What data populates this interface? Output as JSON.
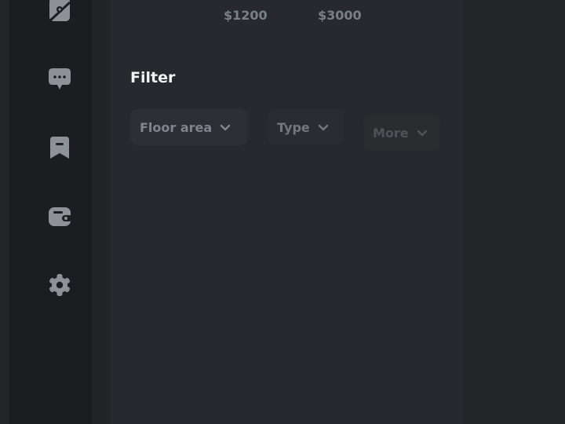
{
  "prices": {
    "min": "$1200",
    "max": "$3000"
  },
  "filter": {
    "title": "Filter",
    "chips": [
      {
        "label": "Floor area"
      },
      {
        "label": "Type"
      },
      {
        "label": "More"
      }
    ]
  },
  "sidebar": {
    "icons": [
      "map-icon",
      "chat-icon",
      "bookmark-icon",
      "wallet-icon",
      "settings-icon"
    ]
  },
  "colors": {
    "background": "#232529",
    "sidebar": "#1b1d20",
    "panel": "#27292e",
    "icon": "#8e9198",
    "title": "#f1f2f4"
  }
}
